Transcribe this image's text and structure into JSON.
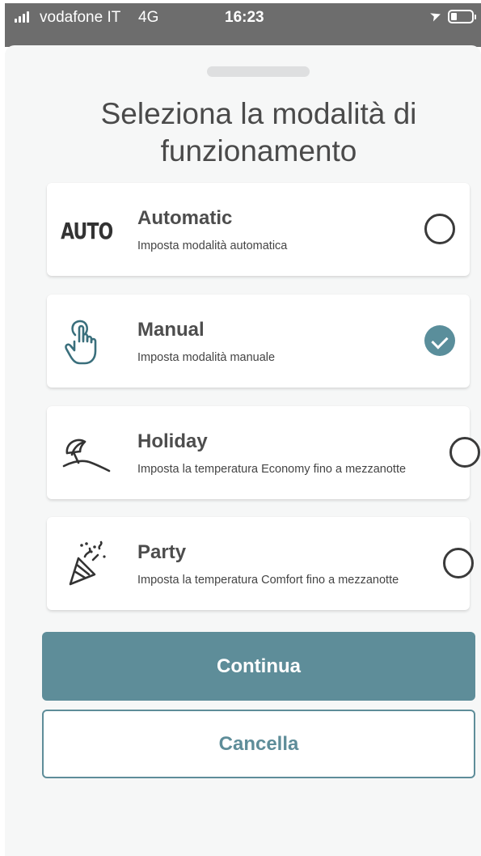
{
  "status_bar": {
    "carrier": "vodafone IT",
    "network": "4G",
    "time": "16:23"
  },
  "title": "Seleziona la modalità di funzionamento",
  "modes": [
    {
      "name": "Automatic",
      "description": "Imposta modalità automatica",
      "icon_label": "AUTO",
      "icon": "auto-icon",
      "selected": false
    },
    {
      "name": "Manual",
      "description": "Imposta modalità manuale",
      "icon": "hand-tap-icon",
      "selected": true
    },
    {
      "name": "Holiday",
      "description": "Imposta la temperatura Economy fino a mezzanotte",
      "icon": "beach-umbrella-icon",
      "selected": false
    },
    {
      "name": "Party",
      "description": "Imposta la temperatura Comfort fino a mezzanotte",
      "icon": "party-popper-icon",
      "selected": false
    }
  ],
  "actions": {
    "continue_label": "Continua",
    "cancel_label": "Cancella"
  },
  "colors": {
    "accent": "#5e8d99",
    "selected_radio": "#5a8e9b",
    "status_bar": "#6d6d6d",
    "sheet_background": "#f6f7f7"
  }
}
